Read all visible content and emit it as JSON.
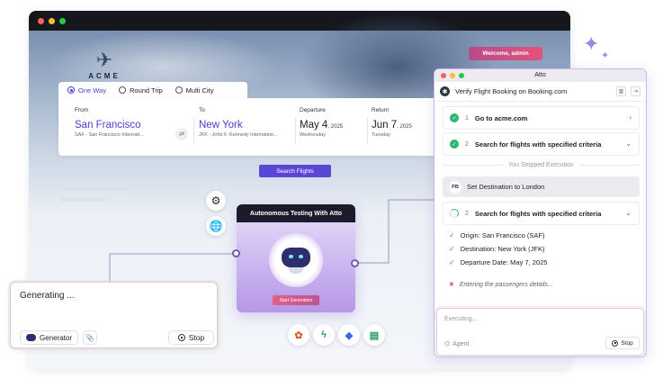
{
  "colors": {
    "accent": "#5b47d6",
    "success": "#2bb673",
    "window_bar": "#15171d"
  },
  "window": {
    "traffic_lights": [
      "#ff5f57",
      "#febc2e",
      "#28c840"
    ]
  },
  "site": {
    "logo_text": "ACME",
    "welcome_label": "Welcome, admin"
  },
  "booking": {
    "trip_types": [
      {
        "label": "One Way",
        "selected": true
      },
      {
        "label": "Round Trip",
        "selected": false
      },
      {
        "label": "Multi City",
        "selected": false
      }
    ],
    "from": {
      "label": "From",
      "city": "San Francisco",
      "detail": "SAF - San Francisco Internati..."
    },
    "to": {
      "label": "To",
      "city": "New York",
      "detail": "JFK - John F. Kennedy Internation..."
    },
    "departure": {
      "label": "Departure",
      "date": "May 4",
      "year": ", 2025",
      "weekday": "Wednesday"
    },
    "return": {
      "label": "Return",
      "date": "Jun 7",
      "year": ", 2025",
      "weekday": "Tuesday"
    },
    "search_button": "Search Flights"
  },
  "ai_card": {
    "title": "Autonomous Testing With Atto",
    "start_button": "Start Generation"
  },
  "integrations": [
    "figma-icon",
    "lightning-icon",
    "jira-icon",
    "sheets-icon"
  ],
  "generator": {
    "status_text": "Generating ...",
    "chip_label": "Generator",
    "stop_label": "Stop"
  },
  "atto": {
    "title": "Atto",
    "task": "Verify Flight Booking on Booking.com",
    "steps_done": [
      {
        "num": "1",
        "label": "Go to acme.com"
      },
      {
        "num": "2",
        "label": "Search for flights with specified criteria"
      }
    ],
    "stopped_text": "You Stopped Execution",
    "pb_badge": "PB",
    "pb_text": "Set Destination to London",
    "running_step": {
      "num": "2",
      "label": "Search for flights with specified criteria"
    },
    "sub_items": [
      "Origin: San Francisco (SAF)",
      "Destination: New York (JFK)",
      "Departure Date: May 7, 2025"
    ],
    "entering_text": "Entering the passengers details...",
    "input_placeholder": "Executing...",
    "agent_label": "Agent",
    "stop_label": "Stop"
  }
}
